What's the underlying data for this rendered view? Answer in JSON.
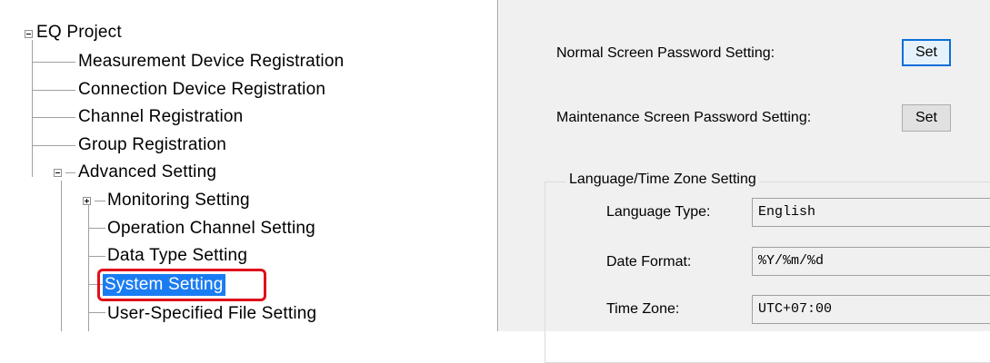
{
  "tree": {
    "root": "EQ Project",
    "items": [
      {
        "label": "Measurement Device Registration"
      },
      {
        "label": "Connection Device Registration"
      },
      {
        "label": "Channel Registration"
      },
      {
        "label": "Group Registration"
      },
      {
        "label": "Advanced Setting"
      },
      {
        "label": "Monitoring Setting"
      },
      {
        "label": "Operation Channel Setting"
      },
      {
        "label": "Data Type Setting"
      },
      {
        "label": "System Setting",
        "selected": true
      },
      {
        "label": "User-Specified File Setting"
      }
    ]
  },
  "settings": {
    "normal_password_label": "Normal Screen Password Setting:",
    "normal_password_button": "Set",
    "maintenance_password_label": "Maintenance Screen Password Setting:",
    "maintenance_password_button": "Set",
    "language_group": {
      "title": "Language/Time Zone Setting",
      "language_type_label": "Language Type:",
      "language_type_value": "English",
      "date_format_label": "Date Format:",
      "date_format_value": "%Y/%m/%d",
      "time_zone_label": "Time Zone:",
      "time_zone_value": "UTC+07:00"
    }
  },
  "colors": {
    "selection": "#1a7cf2",
    "highlight_box": "#e0101a",
    "panel_background": "#f0f0f0"
  }
}
